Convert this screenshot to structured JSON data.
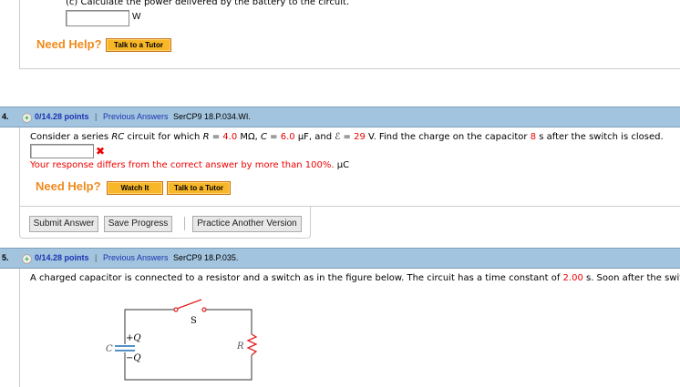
{
  "q3": {
    "part_c": "(c) Calculate the power delivered by the battery to the circuit.",
    "unit": "W",
    "need_help": "Need Help?",
    "tutor_button": "Talk to a Tutor"
  },
  "q4": {
    "number": "4.",
    "points": "0/14.28 points",
    "separator": "|",
    "previous_answers": "Previous Answers",
    "problem_id": "SerCP9 18.P.034.WI.",
    "question": {
      "p1": "Consider a series ",
      "rc": "RC",
      "p2": " circuit for which ",
      "r": "R",
      "p3": " = ",
      "r_val": "4.0",
      "p4": " MΩ, ",
      "c": "C",
      "p5": " = ",
      "c_val": "6.0",
      "p6": " µF, and ",
      "emf": "ℰ",
      "p7": " = ",
      "emf_val": "29",
      "p8": " V. Find the charge on the capacitor ",
      "t_val": "8",
      "p9": " s after the switch is closed."
    },
    "wrong_mark": "✖",
    "feedback": "Your response differs from the correct answer by more than 100%.",
    "unit": "µC",
    "need_help": "Need Help?",
    "watch_button": "Watch It",
    "tutor_button": "Talk to a Tutor",
    "submit_button": "Submit Answer",
    "save_button": "Save Progress",
    "practice_button": "Practice Another Version"
  },
  "q5": {
    "number": "5.",
    "points": "0/14.28 points",
    "separator": "|",
    "previous_answers": "Previous Answers",
    "problem_id": "SerCP9 18.P.035.",
    "question": {
      "p1": "A charged capacitor is connected to a resistor and a switch as in the figure below. The circuit has a time constant of ",
      "tau_val": "2.00",
      "p2": " s. Soon after the switch"
    },
    "figure": {
      "switch_label": "S",
      "plus_q": "+Q",
      "minus_q": "−Q",
      "c_label": "C",
      "r_label": "R"
    }
  },
  "colors": {
    "accent_red": "#e00000",
    "header_bar": "#a3c4df",
    "need_help": "#f08a1c"
  }
}
